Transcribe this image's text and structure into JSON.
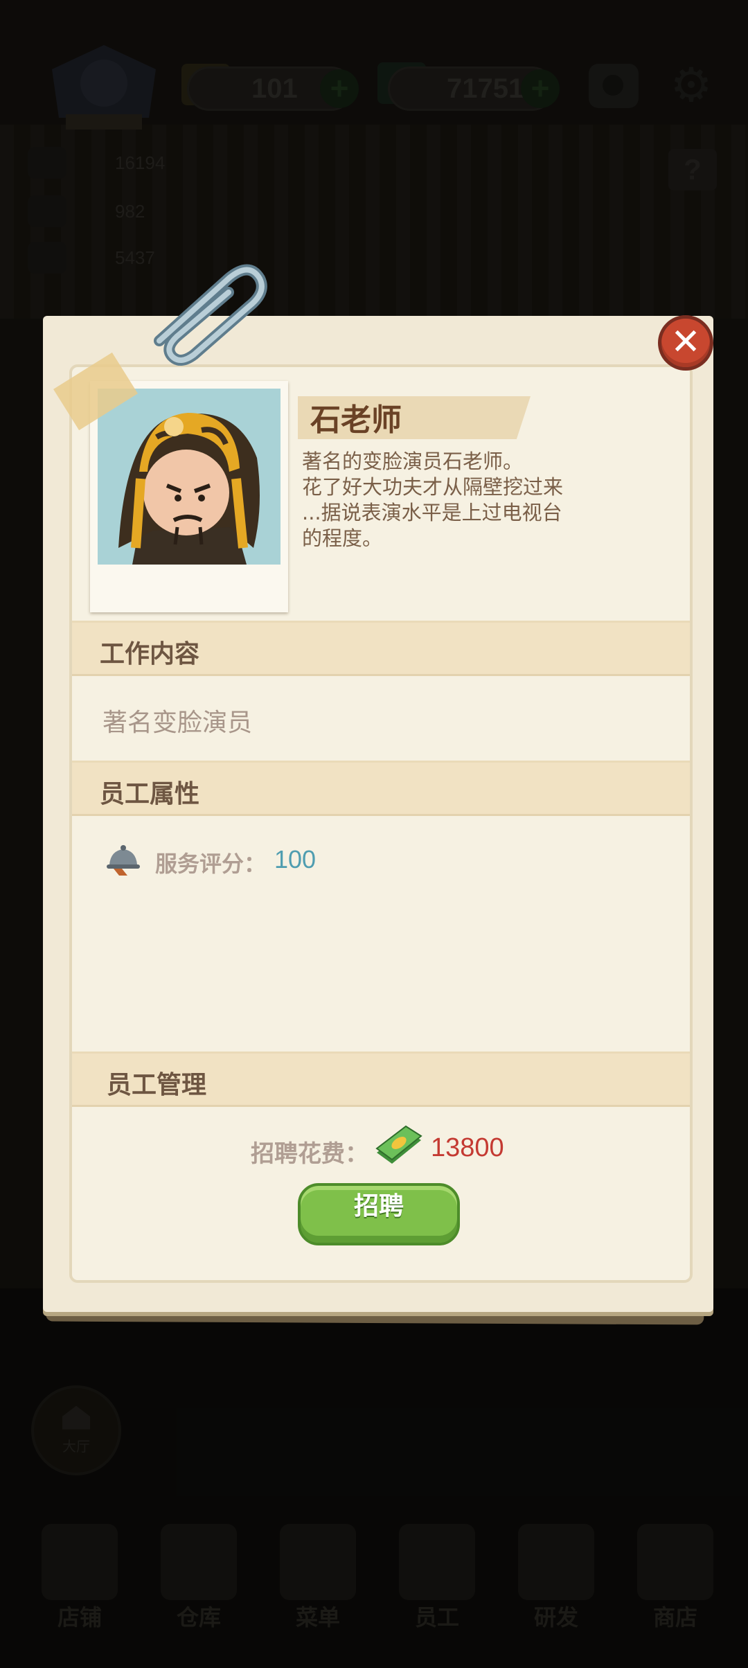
{
  "hud": {
    "gems": "101",
    "cash": "71751",
    "plus_label": "+",
    "stats": [
      "16194",
      "982",
      "5437"
    ],
    "help_label": "?"
  },
  "hall_button": {
    "label": "大厅"
  },
  "bottom_nav": [
    {
      "label": "店铺"
    },
    {
      "label": "仓库"
    },
    {
      "label": "菜单"
    },
    {
      "label": "员工"
    },
    {
      "label": "研发"
    },
    {
      "label": "商店"
    }
  ],
  "dialog": {
    "close_label": "✕",
    "name": "石老师",
    "description_lines": [
      "著名的变脸演员石老师。",
      "花了好大功夫才从隔壁挖过来",
      "...据说表演水平是上过电视台",
      "的程度。"
    ],
    "sections": {
      "job": {
        "title": "工作内容",
        "text": "著名变脸演员"
      },
      "attributes": {
        "title": "员工属性",
        "service_label": "服务评分：",
        "service_value": "100"
      },
      "management": {
        "title": "员工管理",
        "cost_label": "招聘花费：",
        "cost_value": "13800",
        "hire_label": "招聘"
      }
    }
  },
  "colors": {
    "close_red": "#c8472f",
    "hire_green": "#7fc04a",
    "cost_red": "#c43a32",
    "service_blue": "#4f9db0"
  }
}
